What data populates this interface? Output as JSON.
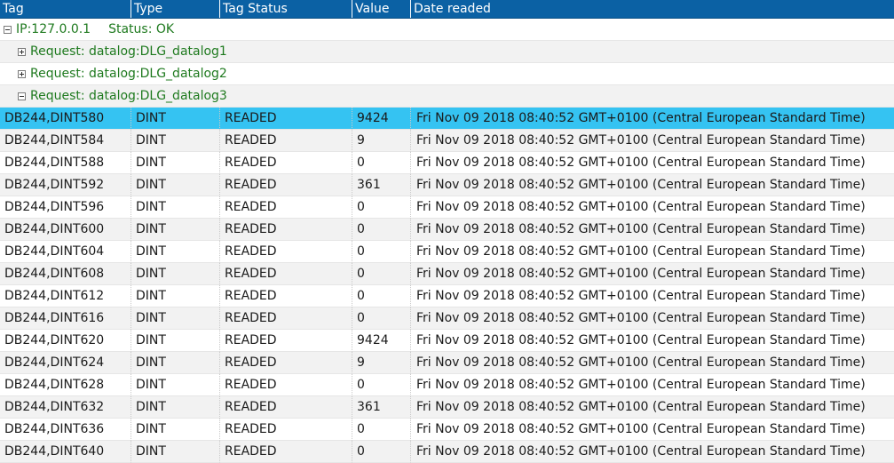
{
  "header": {
    "columns": [
      "Tag",
      "Type",
      "Tag Status",
      "Value",
      "Date readed"
    ]
  },
  "groups": {
    "ip": {
      "label": "IP:127.0.0.1",
      "status": "Status: OK",
      "expanded": true
    },
    "requests": [
      {
        "label": "Request: datalog:DLG_datalog1",
        "expanded": false
      },
      {
        "label": "Request: datalog:DLG_datalog2",
        "expanded": false
      },
      {
        "label": "Request: datalog:DLG_datalog3",
        "expanded": true
      }
    ]
  },
  "colors": {
    "header_bg": "#0b61a4",
    "selected_row": "#35c3f2",
    "group_text": "#1f7a1f"
  },
  "rows": [
    {
      "tag": "DB244,DINT580",
      "type": "DINT",
      "status": "READED",
      "value": "9424",
      "date": "Fri Nov 09 2018 08:40:52 GMT+0100 (Central European Standard Time)",
      "selected": true
    },
    {
      "tag": "DB244,DINT584",
      "type": "DINT",
      "status": "READED",
      "value": "9",
      "date": "Fri Nov 09 2018 08:40:52 GMT+0100 (Central European Standard Time)"
    },
    {
      "tag": "DB244,DINT588",
      "type": "DINT",
      "status": "READED",
      "value": "0",
      "date": "Fri Nov 09 2018 08:40:52 GMT+0100 (Central European Standard Time)"
    },
    {
      "tag": "DB244,DINT592",
      "type": "DINT",
      "status": "READED",
      "value": "361",
      "date": "Fri Nov 09 2018 08:40:52 GMT+0100 (Central European Standard Time)"
    },
    {
      "tag": "DB244,DINT596",
      "type": "DINT",
      "status": "READED",
      "value": "0",
      "date": "Fri Nov 09 2018 08:40:52 GMT+0100 (Central European Standard Time)"
    },
    {
      "tag": "DB244,DINT600",
      "type": "DINT",
      "status": "READED",
      "value": "0",
      "date": "Fri Nov 09 2018 08:40:52 GMT+0100 (Central European Standard Time)"
    },
    {
      "tag": "DB244,DINT604",
      "type": "DINT",
      "status": "READED",
      "value": "0",
      "date": "Fri Nov 09 2018 08:40:52 GMT+0100 (Central European Standard Time)"
    },
    {
      "tag": "DB244,DINT608",
      "type": "DINT",
      "status": "READED",
      "value": "0",
      "date": "Fri Nov 09 2018 08:40:52 GMT+0100 (Central European Standard Time)"
    },
    {
      "tag": "DB244,DINT612",
      "type": "DINT",
      "status": "READED",
      "value": "0",
      "date": "Fri Nov 09 2018 08:40:52 GMT+0100 (Central European Standard Time)"
    },
    {
      "tag": "DB244,DINT616",
      "type": "DINT",
      "status": "READED",
      "value": "0",
      "date": "Fri Nov 09 2018 08:40:52 GMT+0100 (Central European Standard Time)"
    },
    {
      "tag": "DB244,DINT620",
      "type": "DINT",
      "status": "READED",
      "value": "9424",
      "date": "Fri Nov 09 2018 08:40:52 GMT+0100 (Central European Standard Time)"
    },
    {
      "tag": "DB244,DINT624",
      "type": "DINT",
      "status": "READED",
      "value": "9",
      "date": "Fri Nov 09 2018 08:40:52 GMT+0100 (Central European Standard Time)"
    },
    {
      "tag": "DB244,DINT628",
      "type": "DINT",
      "status": "READED",
      "value": "0",
      "date": "Fri Nov 09 2018 08:40:52 GMT+0100 (Central European Standard Time)"
    },
    {
      "tag": "DB244,DINT632",
      "type": "DINT",
      "status": "READED",
      "value": "361",
      "date": "Fri Nov 09 2018 08:40:52 GMT+0100 (Central European Standard Time)"
    },
    {
      "tag": "DB244,DINT636",
      "type": "DINT",
      "status": "READED",
      "value": "0",
      "date": "Fri Nov 09 2018 08:40:52 GMT+0100 (Central European Standard Time)"
    },
    {
      "tag": "DB244,DINT640",
      "type": "DINT",
      "status": "READED",
      "value": "0",
      "date": "Fri Nov 09 2018 08:40:52 GMT+0100 (Central European Standard Time)"
    }
  ]
}
